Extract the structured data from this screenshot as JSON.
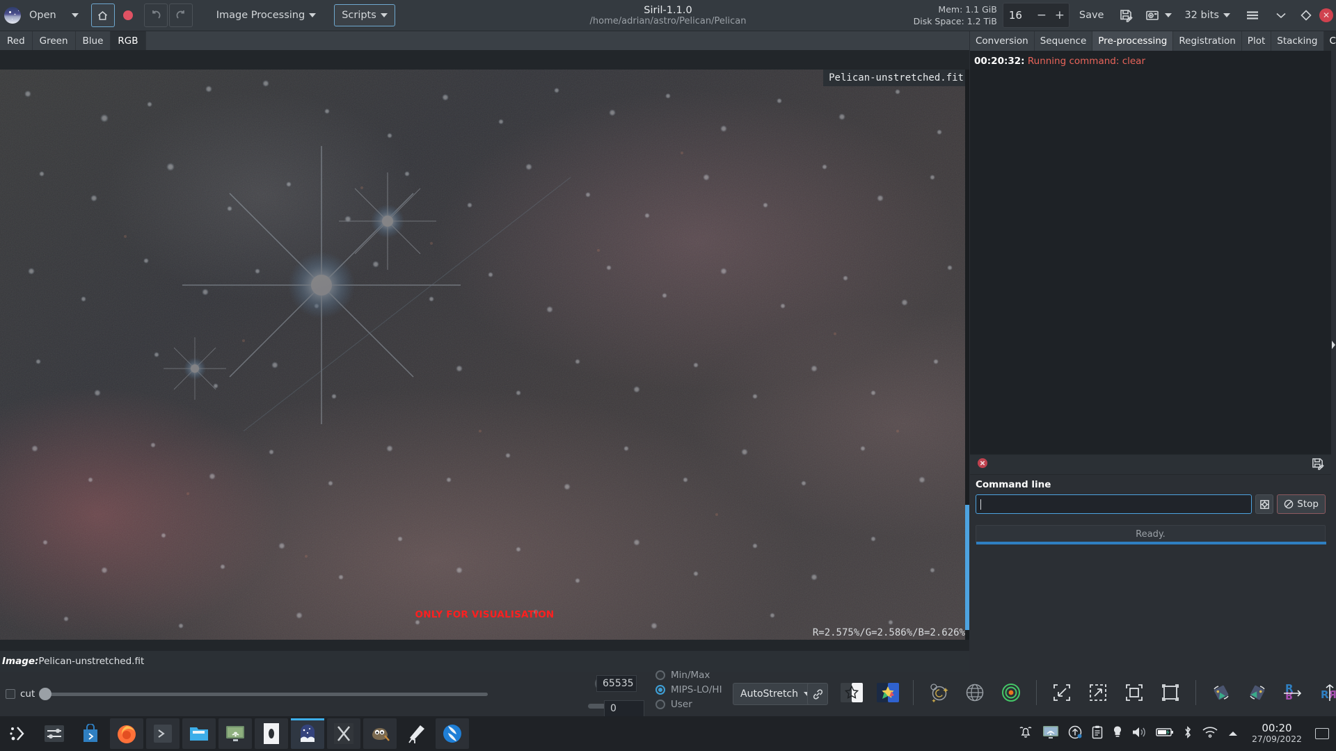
{
  "header": {
    "app_logo": "siril-logo-icon",
    "open_label": "Open",
    "open_caret": "chevron-down-icon",
    "home_icon": "home-icon",
    "record_icon": "record-dot-icon",
    "undo_icon": "undo-icon",
    "redo_icon": "redo-icon",
    "image_processing_label": "Image Processing",
    "scripts_label": "Scripts",
    "title": "Siril-1.1.0",
    "subtitle": "/home/adrian/astro/Pelican/Pelican",
    "mem_label": "Mem: 1.1 GiB",
    "disk_label": "Disk Space: 1.2 TiB",
    "zoom_value": "16",
    "zoom_minus": "−",
    "zoom_plus": "+",
    "save_label": "Save",
    "save_as_icon": "save-as-icon",
    "snapshot_icon": "camera-snapshot-icon",
    "bitdepth_label": "32 bits",
    "menu_icon": "hamburger-menu-icon",
    "collapse_icon": "chevron-down-icon",
    "shortcuts_icon": "diamond-icon",
    "close_label": "✕"
  },
  "channel_tabs": [
    {
      "label": "Red",
      "active": false
    },
    {
      "label": "Green",
      "active": false
    },
    {
      "label": "Blue",
      "active": false
    },
    {
      "label": "RGB",
      "active": true
    }
  ],
  "image_view": {
    "overlay_filename": "Pelican-unstretched.fit",
    "visualisation_warning": "ONLY FOR VISUALISATION",
    "pixel_readout": "R=2.575%/G=2.586%/B=2.626%",
    "status_prefix": "Image:",
    "status_filename": "Pelican-unstretched.fit"
  },
  "display_controls": {
    "cut_label": "cut",
    "high_value": "65535",
    "low_value": "0",
    "radios": [
      {
        "label": "Min/Max",
        "selected": false
      },
      {
        "label": "MIPS-LO/HI",
        "selected": true
      },
      {
        "label": "User",
        "selected": false
      }
    ],
    "stretch_mode": "AutoStretch",
    "chain_icon": "chain-link-icon",
    "tool_icons": [
      "bw-star-icon",
      "color-star-icon",
      "astrometry-icon",
      "grid-globe-icon",
      "target-reticle-icon",
      "zoom-fit-icon",
      "zoom-expand-icon",
      "zoom-one-to-one-icon",
      "selection-frame-icon",
      "rotate-left-icon",
      "rotate-right-icon",
      "flip-vertical-icon",
      "flip-horizontal-icon",
      "image-stack-icon"
    ]
  },
  "right_panel": {
    "tabs": [
      {
        "label": "Conversion",
        "state": "normal"
      },
      {
        "label": "Sequence",
        "state": "normal"
      },
      {
        "label": "Pre-processing",
        "state": "selected"
      },
      {
        "label": "Registration",
        "state": "normal"
      },
      {
        "label": "Plot",
        "state": "normal"
      },
      {
        "label": "Stacking",
        "state": "normal"
      },
      {
        "label": "Console",
        "state": "active"
      }
    ],
    "console_lines": [
      {
        "time": "00:20:32:",
        "message": "Running command: clear"
      }
    ],
    "console_clear_icon": "clear-console-icon",
    "console_export_icon": "export-log-icon",
    "command_label": "Command line",
    "command_value": "",
    "command_placeholder": "",
    "help_icon": "command-help-icon",
    "stop_label": "Stop",
    "stop_icon": "stop-circle-icon",
    "progress_text": "Ready.",
    "edge_arrow_icon": "expand-panel-arrow-icon"
  },
  "taskbar": {
    "launchers": [
      "kde-menu-icon",
      "settings-sliders-icon",
      "software-store-icon"
    ],
    "windows": [
      {
        "icon": "firefox-icon",
        "active": false
      },
      {
        "icon": "terminal-icon",
        "active": false
      },
      {
        "icon": "file-manager-icon",
        "active": false
      },
      {
        "icon": "remote-desktop-icon",
        "active": false
      },
      {
        "icon": "galaxy-app-icon",
        "active": false
      },
      {
        "icon": "siril-icon",
        "active": true
      },
      {
        "icon": "pixinsight-icon",
        "active": false
      },
      {
        "icon": "gimp-icon",
        "active": false
      },
      {
        "icon": "telescope-icon",
        "active": false
      },
      {
        "icon": "kstars-icon",
        "active": false
      }
    ],
    "tray": [
      "notifications-bell-icon",
      "display-sharing-icon",
      "updates-icon",
      "clipboard-icon",
      "brightness-icon",
      "volume-icon",
      "battery-icon",
      "bluetooth-icon",
      "wifi-icon",
      "show-hidden-tray-arrow-icon"
    ],
    "clock_time": "00:20",
    "clock_date": "27/09/2022",
    "show_desktop_icon": "show-desktop-icon"
  },
  "colors": {
    "accent_blue": "#4da3e0",
    "warning_red": "#ff1f1f",
    "log_red": "#e8645a",
    "chrome": "#343a40",
    "panel": "#2b2f34"
  }
}
